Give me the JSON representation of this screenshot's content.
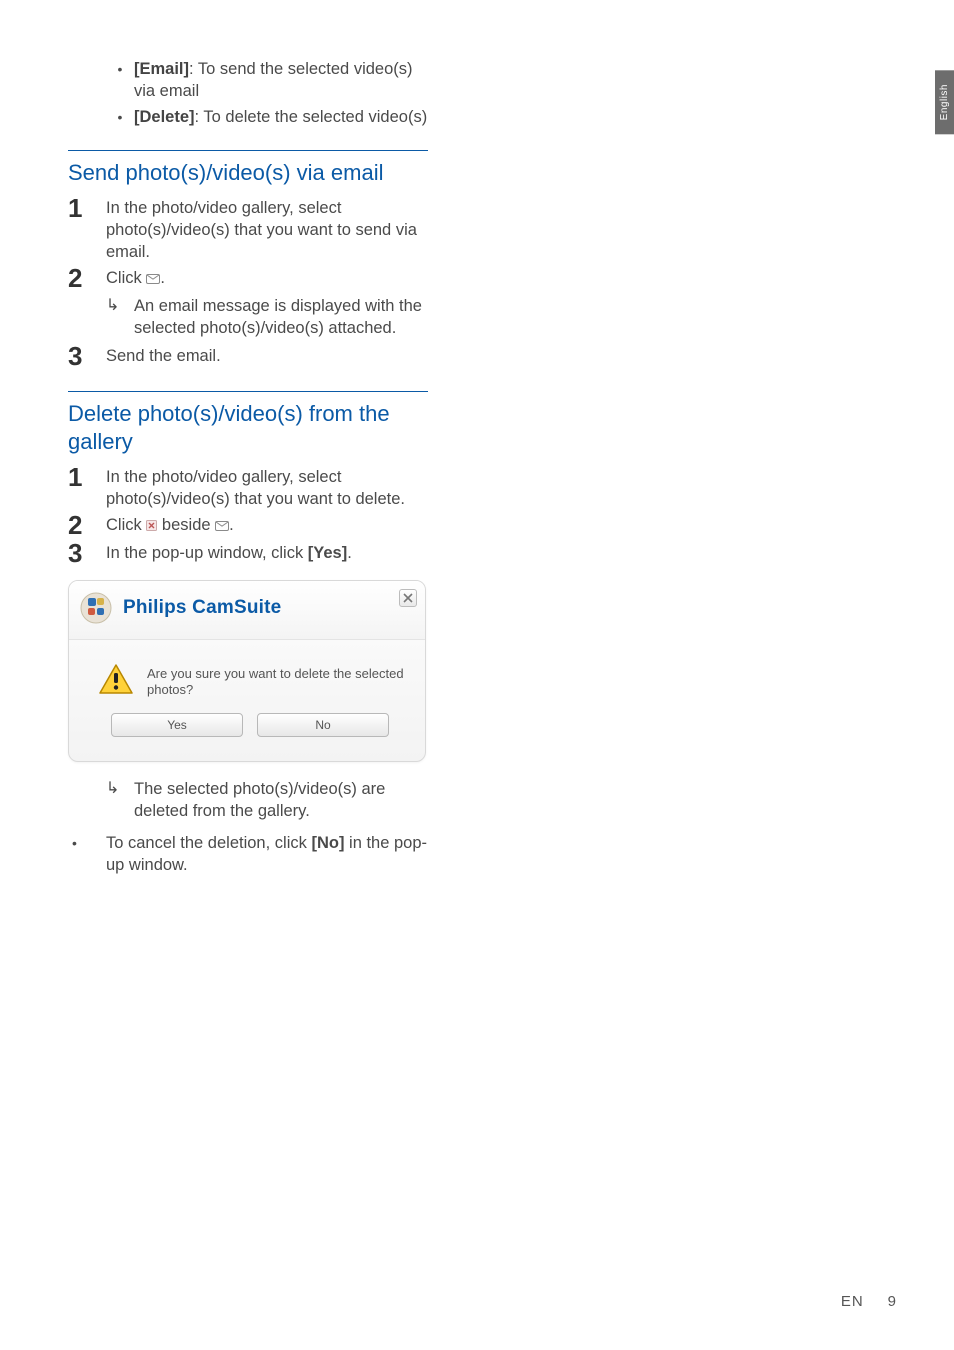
{
  "langTab": "English",
  "intro_bullets": [
    {
      "label": "[Email]",
      "rest": ": To send the selected video(s) via email"
    },
    {
      "label": "[Delete]",
      "rest": ": To delete the selected video(s)"
    }
  ],
  "section_email": {
    "heading": "Send photo(s)/video(s) via email",
    "step1": "In the photo/video gallery, select photo(s)/video(s) that you want to send via email.",
    "step2_prefix": "Click ",
    "step2_suffix": ".",
    "step2_result": "An email message is displayed with the selected photo(s)/video(s) attached.",
    "step3": "Send the email."
  },
  "section_delete": {
    "heading": "Delete photo(s)/video(s) from the gallery",
    "step1": "In the photo/video gallery, select photo(s)/video(s) that you want to delete.",
    "step2_prefix": "Click ",
    "step2_mid": " beside ",
    "step2_suffix": ".",
    "step3_prefix": "In the pop-up window, click ",
    "step3_bold": "[Yes]",
    "step3_suffix": "."
  },
  "dialog": {
    "title": "Philips CamSuite",
    "message": "Are you sure you want to delete the selected photos?",
    "yes": "Yes",
    "no": "No"
  },
  "after_dialog": {
    "result": "The selected photo(s)/video(s) are deleted from the gallery.",
    "cancel_prefix": "To cancel the deletion, click ",
    "cancel_bold": "[No]",
    "cancel_suffix": " in the pop-up window."
  },
  "footer": {
    "lang": "EN",
    "page": "9"
  }
}
